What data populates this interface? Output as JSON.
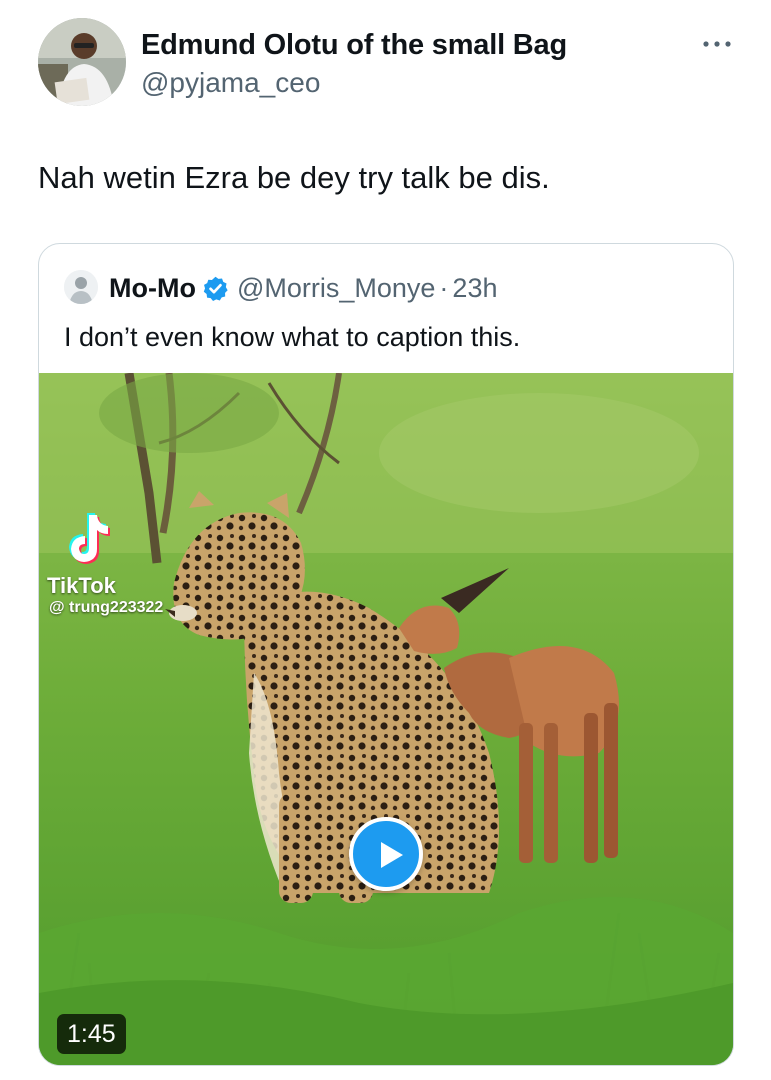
{
  "tweet": {
    "author_name": "Edmund Olotu of the small Bag",
    "author_handle": "@pyjama_ceo",
    "text": "Nah wetin Ezra be dey try talk be dis.",
    "more_icon": "ellipsis-icon"
  },
  "quoted": {
    "name": "Mo-Mo",
    "verified_icon": "verified-badge-icon",
    "handle": "@Morris_Monye",
    "separator": "·",
    "time": "23h",
    "text": "I don’t even know what to caption this."
  },
  "video": {
    "watermark_brand": "TikTok",
    "watermark_user": "@ trung223322",
    "duration": "1:45",
    "play_icon": "play-icon",
    "description": ""
  },
  "colors": {
    "accent": "#1d9bf0",
    "secondary_text": "#536471",
    "border": "#cfd9de"
  }
}
